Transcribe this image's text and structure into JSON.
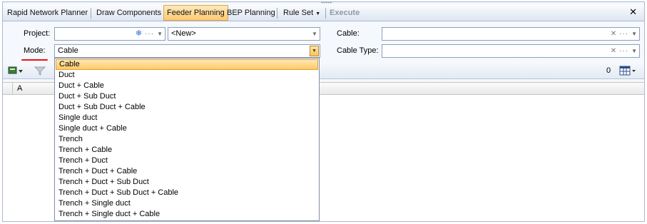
{
  "toolbar": {
    "tabs": [
      {
        "label": "Rapid Network Planner",
        "state": "normal"
      },
      {
        "label": "Draw Components",
        "state": "normal"
      },
      {
        "label": "Feeder Planning",
        "state": "active"
      },
      {
        "label": "BEP Planning",
        "state": "normal"
      },
      {
        "label": "Rule Set",
        "state": "normal"
      },
      {
        "label": "Execute",
        "state": "disabled"
      }
    ],
    "close_glyph": "✕"
  },
  "form": {
    "project_label": "Project:",
    "project_value": "",
    "project_secondary": "<New>",
    "mode_label": "Mode:",
    "mode_value": "Cable",
    "cable_label": "Cable:",
    "cable_value": "",
    "cable_type_label": "Cable Type:",
    "cable_type_value": ""
  },
  "subtoolbar": {
    "count": "0"
  },
  "grid": {
    "columns": [
      "A"
    ]
  },
  "mode_dropdown": {
    "selected_index": 0,
    "options": [
      "Cable",
      "Duct",
      "Duct + Cable",
      "Duct + Sub Duct",
      "Duct + Sub Duct + Cable",
      "Single duct",
      "Single duct + Cable",
      "Trench",
      "Trench + Cable",
      "Trench + Duct",
      "Trench + Duct + Cable",
      "Trench + Duct + Sub Duct",
      "Trench + Duct + Sub Duct + Cable",
      "Trench + Single duct",
      "Trench + Single duct + Cable"
    ]
  },
  "colors": {
    "accent_active": "#ffc973",
    "annotation_red": "#e11111",
    "panel_border": "#a9b8cf"
  }
}
